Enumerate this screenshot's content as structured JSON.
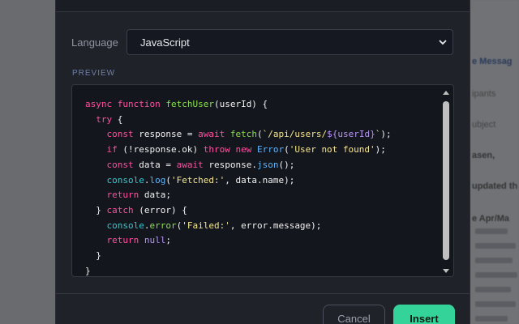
{
  "background_page": {
    "fragments": [
      "e Messag",
      "ipants",
      "ubject",
      "asen,",
      "updated th",
      "e Apr/Ma"
    ]
  },
  "language": {
    "label": "Language",
    "selected": "JavaScript"
  },
  "preview": {
    "label": "PREVIEW",
    "code_lines": [
      "async function fetchUser(userId) {",
      "  try {",
      "    const response = await fetch(`/api/users/${userId}`);",
      "    if (!response.ok) throw new Error('User not found');",
      "    const data = await response.json();",
      "    console.log('Fetched:', data.name);",
      "    return data;",
      "  } catch (error) {",
      "    console.error('Failed:', error.message);",
      "    return null;",
      "  }",
      "}"
    ]
  },
  "actions": {
    "cancel": "Cancel",
    "insert": "Insert"
  },
  "colors": {
    "keyword": "#ff4fa0",
    "function": "#8be04a",
    "string": "#f6e58d",
    "accent": "#34d399"
  }
}
